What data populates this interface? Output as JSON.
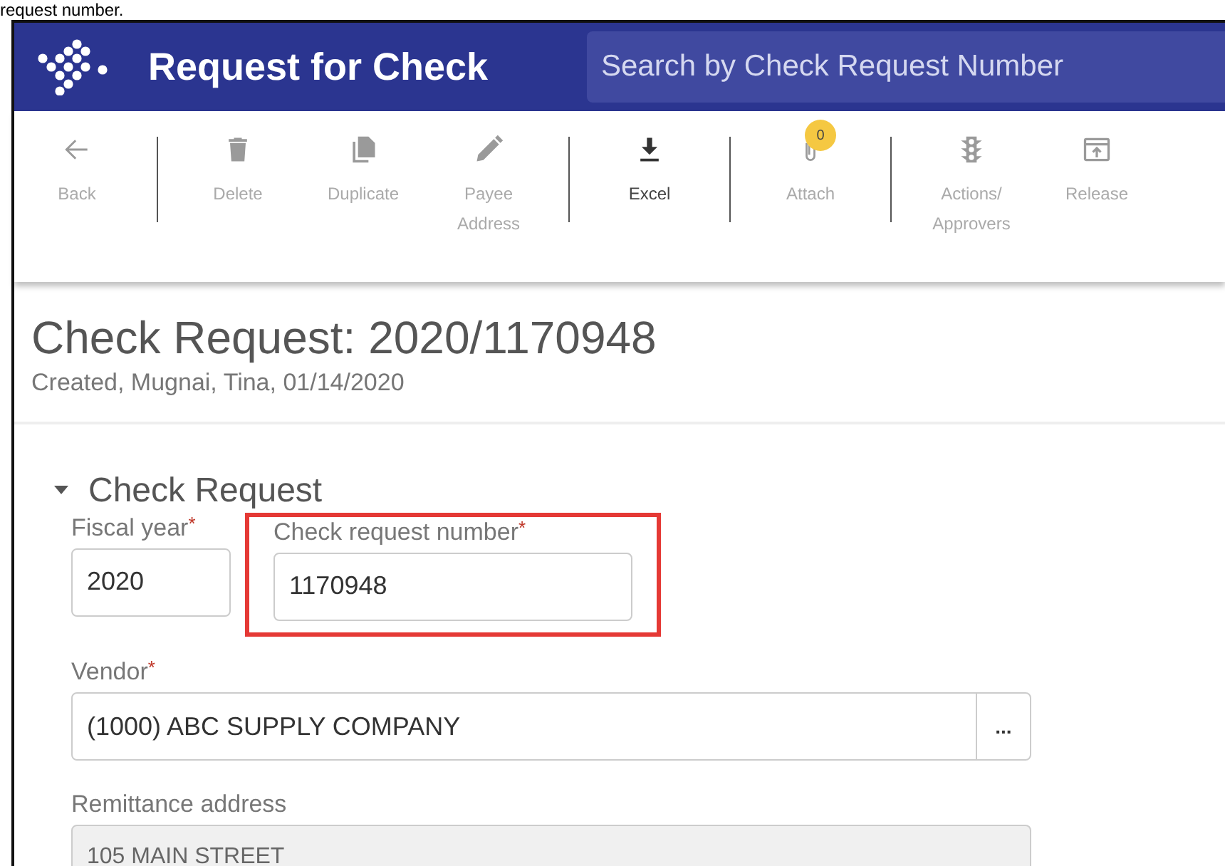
{
  "caption": "request number.",
  "header": {
    "title": "Request for Check",
    "search": {
      "placeholder": "Search by Check Request Number"
    }
  },
  "toolbar": [
    {
      "kind": "back",
      "label": "Back",
      "disabled": true,
      "separator_after": true
    },
    {
      "kind": "delete",
      "label": "Delete",
      "disabled": true,
      "separator_after": false
    },
    {
      "kind": "duplicate",
      "label": "Duplicate",
      "disabled": true,
      "separator_after": false
    },
    {
      "kind": "edit",
      "label": "Payee Address",
      "disabled": true,
      "separator_after": true
    },
    {
      "kind": "download",
      "label": "Excel",
      "disabled": false,
      "separator_after": true
    },
    {
      "kind": "attach",
      "label": "Attach",
      "disabled": true,
      "badge": "0",
      "separator_after": true
    },
    {
      "kind": "traffic",
      "label": "Actions/ Approvers",
      "disabled": true,
      "separator_after": false
    },
    {
      "kind": "release",
      "label": "Release",
      "disabled": true,
      "separator_after": false
    }
  ],
  "page": {
    "title": "Check Request: 2020/1170948",
    "subtitle": "Created, Mugnai, Tina, 01/14/2020"
  },
  "section": {
    "title": "Check Request",
    "expanded": true
  },
  "fields": {
    "fiscal_year": {
      "label": "Fiscal year",
      "required": "*",
      "value": "2020"
    },
    "number": {
      "label": "Check request number",
      "required": "*",
      "value": "1170948",
      "highlighted": true
    },
    "vendor": {
      "label": "Vendor",
      "required": "*",
      "value": "(1000) ABC SUPPLY COMPANY",
      "button": "..."
    },
    "remittance": {
      "label": "Remittance address",
      "value": "105 MAIN STREET",
      "disabled": true
    }
  }
}
